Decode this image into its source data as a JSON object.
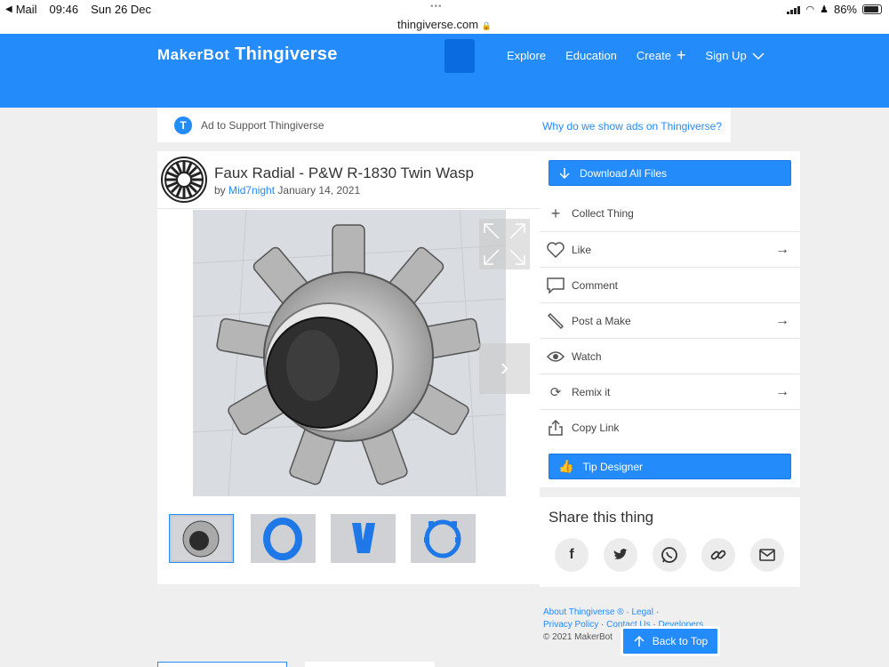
{
  "status": {
    "back_label": "Mail",
    "time": "09:46",
    "date": "Sun 26 Dec",
    "url": "thingiverse.com",
    "battery": "86%"
  },
  "header": {
    "logo_makerbot": "MakerBot",
    "logo_thingiverse": "Thingiverse",
    "nav": [
      "Explore",
      "Education",
      "Create",
      "Sign Up"
    ]
  },
  "ad": {
    "icon_letter": "T",
    "text": "Ad to Support Thingiverse",
    "link": "Why do we show ads on Thingiverse?"
  },
  "thing": {
    "title": "Faux Radial - P&W R-1830 Twin Wasp",
    "by": "by",
    "author": "Mid7night",
    "date": "January 14, 2021"
  },
  "actions": {
    "download": "Download All Files",
    "items": [
      {
        "label": "Collect Thing",
        "icon": "plus-icon",
        "arrow": false
      },
      {
        "label": "Like",
        "icon": "heart-icon",
        "arrow": true
      },
      {
        "label": "Comment",
        "icon": "comment-icon",
        "arrow": false
      },
      {
        "label": "Post a Make",
        "icon": "brush-icon",
        "arrow": true
      },
      {
        "label": "Watch",
        "icon": "eye-icon",
        "arrow": false
      },
      {
        "label": "Remix it",
        "icon": "remix-icon",
        "arrow": true
      },
      {
        "label": "Copy Link",
        "icon": "share-icon",
        "arrow": false
      }
    ],
    "tip": "Tip Designer"
  },
  "share": {
    "title": "Share this thing"
  },
  "footer": {
    "about": "About Thingiverse ®",
    "legal": "Legal",
    "privacy": "Privacy Policy",
    "contact": "Contact Us",
    "developers": "Developers",
    "copyright": "© 2021 MakerBot",
    "back_to_top": "Back to Top"
  },
  "colors": {
    "brand": "#248bfb",
    "background": "#efefef"
  }
}
